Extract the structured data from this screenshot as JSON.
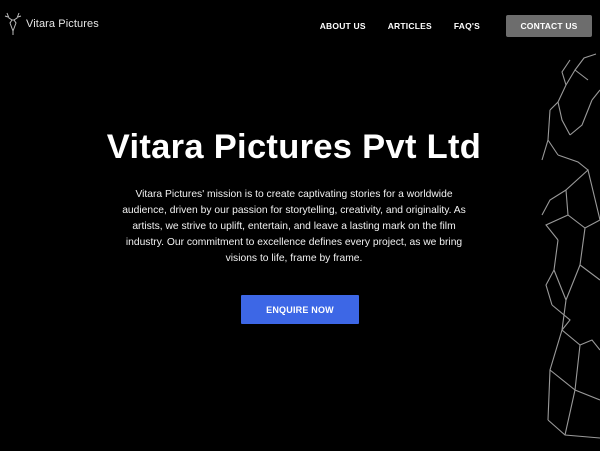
{
  "brand": {
    "name": "Vitara Pictures",
    "logo_icon": "deer-head-icon"
  },
  "nav": {
    "links": [
      "ABOUT US",
      "ARTICLES",
      "FAQ'S"
    ],
    "contact_label": "CONTACT US"
  },
  "hero": {
    "title": "Vitara Pictures Pvt Ltd",
    "description": "Vitara Pictures' mission is to create captivating stories for a worldwide audience, driven by our passion for storytelling, creativity, and originality. As artists, we strive to uplift, entertain, and leave a lasting mark on the film industry. Our commitment to excellence defines every project, as we bring visions to life, frame by frame.",
    "cta_label": "ENQUIRE NOW"
  },
  "colors": {
    "background": "#000000",
    "cta": "#3d67e6",
    "contact_button": "#6d6d6d",
    "outline": "#9a9a9a"
  }
}
